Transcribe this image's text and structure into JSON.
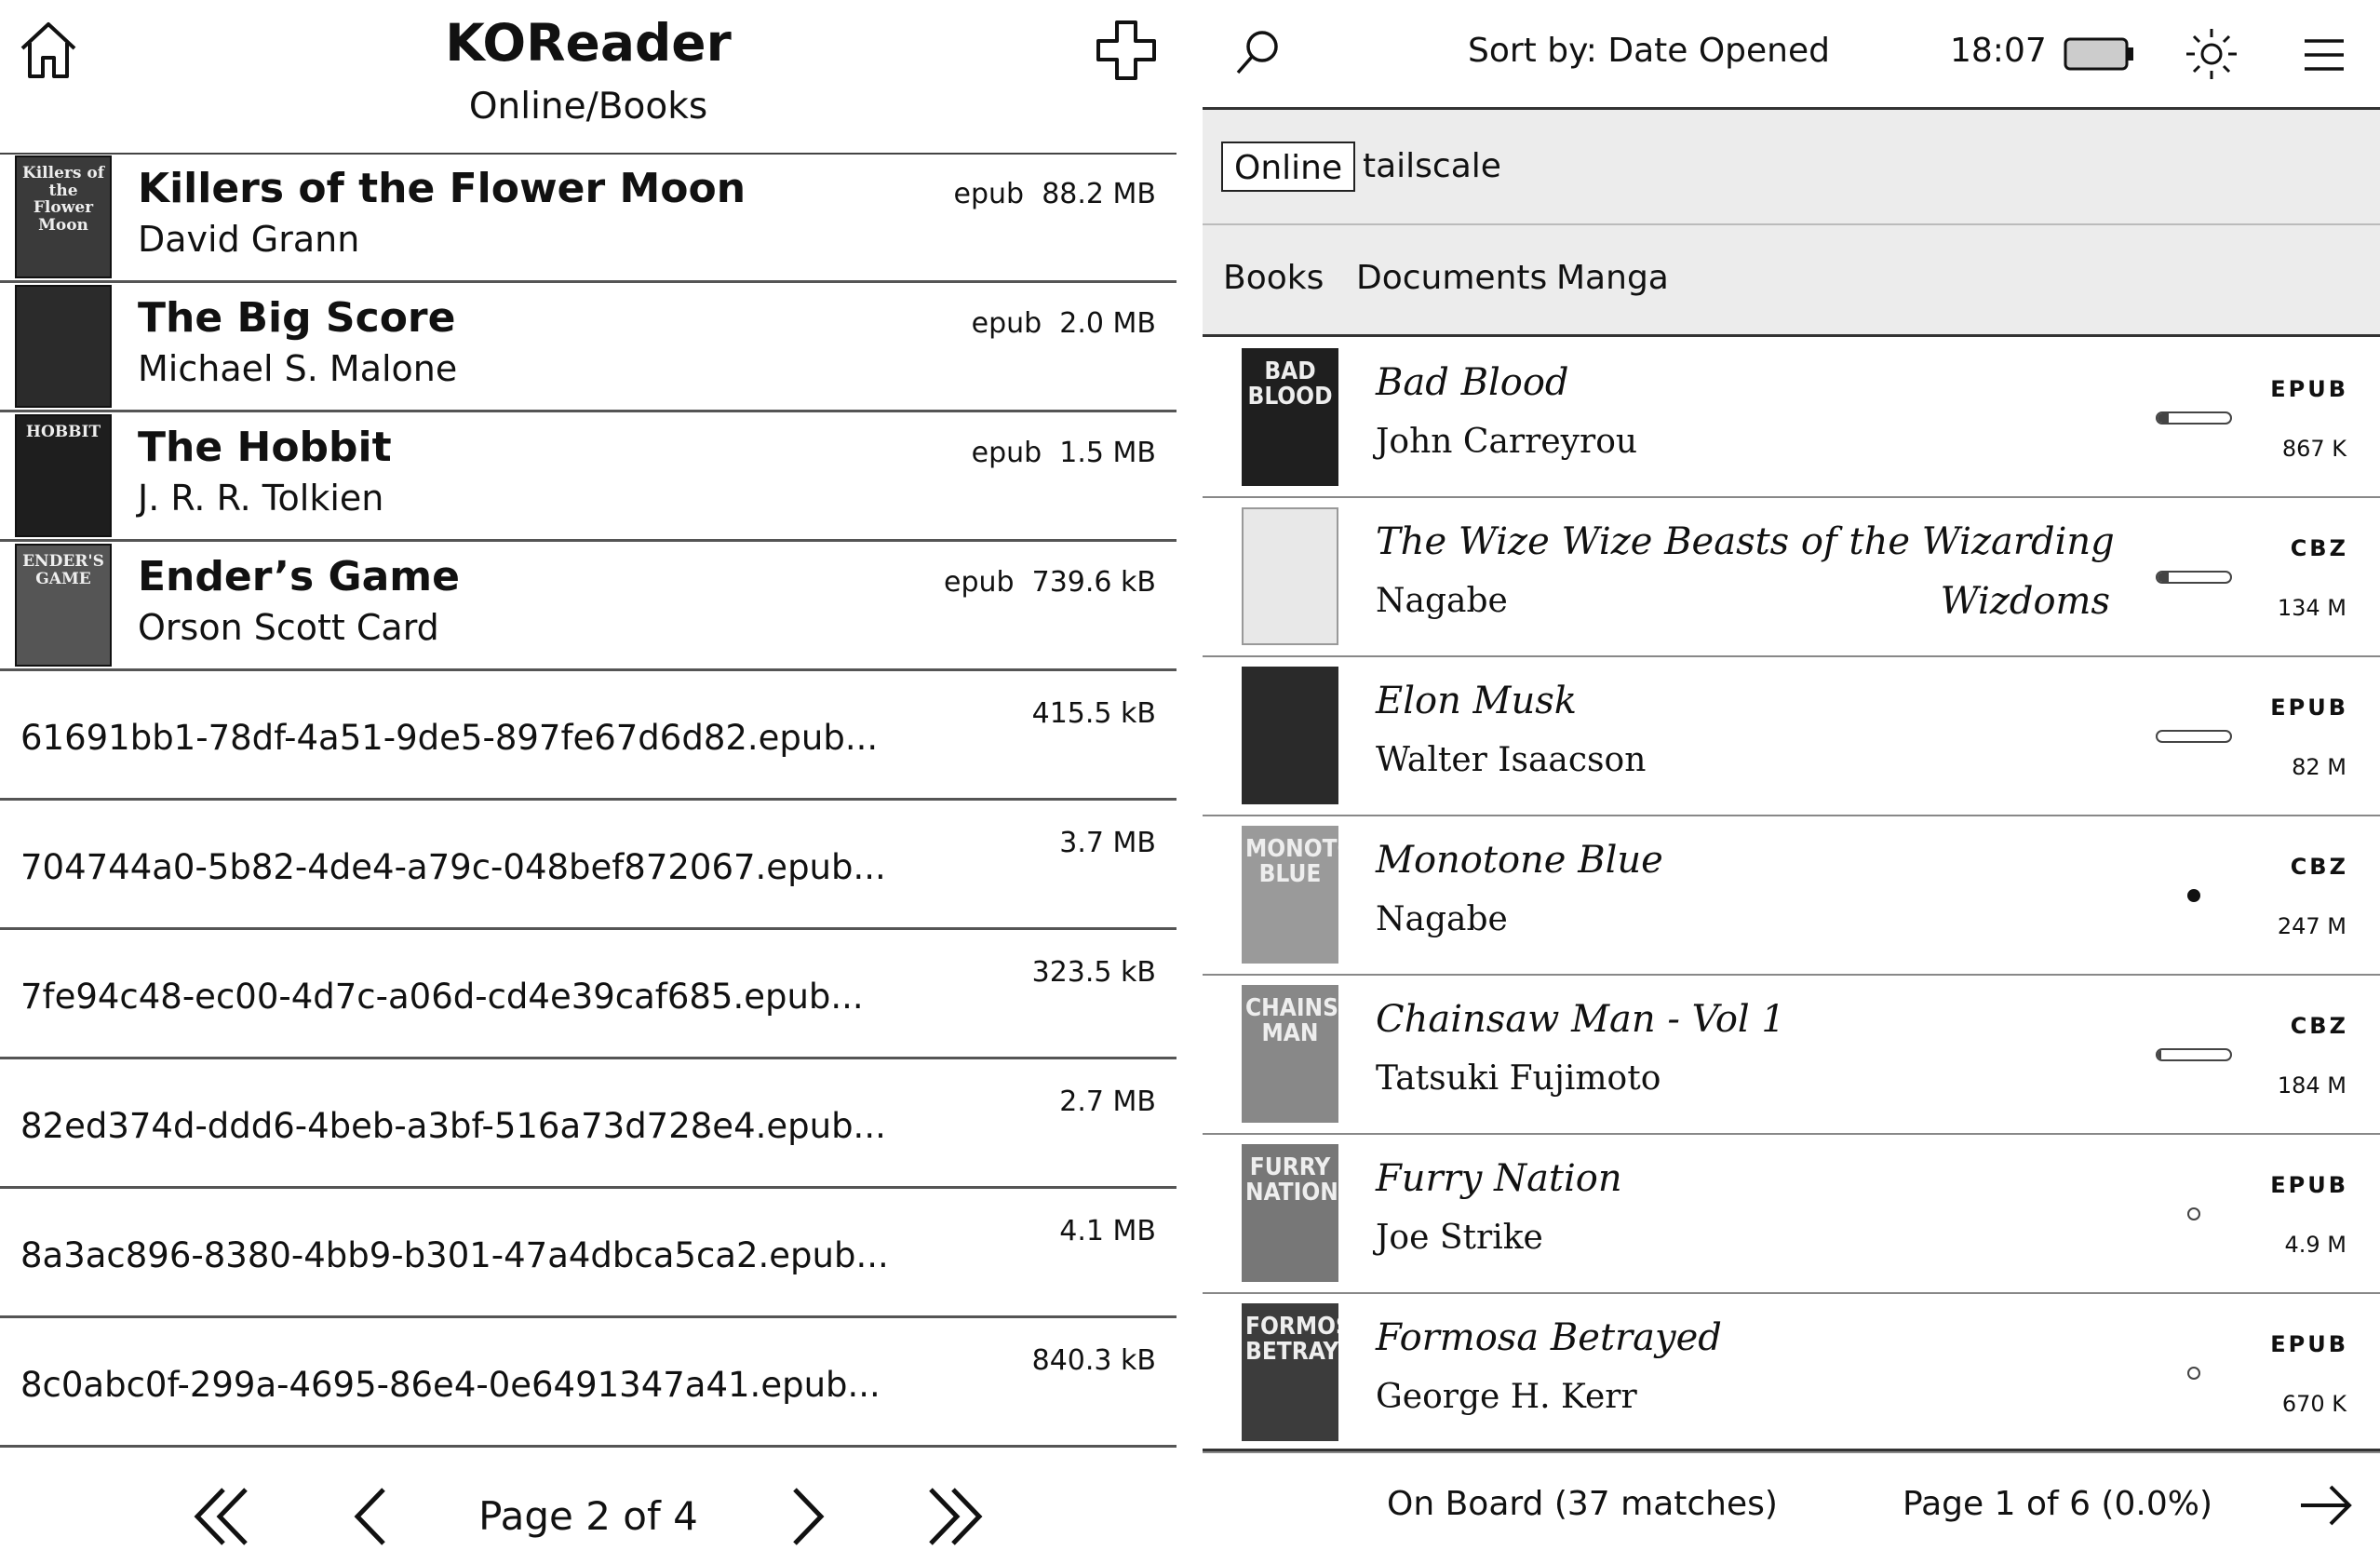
{
  "left": {
    "header": {
      "title": "KOReader",
      "subtitle": "Online/Books"
    },
    "books": [
      {
        "title": "Killers of the Flower Moon",
        "author": "David Grann",
        "format": "epub",
        "size": "88.2 MB",
        "cover_text": "Killers of the Flower Moon"
      },
      {
        "title": "The Big Score",
        "author": "Michael S. Malone",
        "format": "epub",
        "size": "2.0 MB",
        "cover_text": ""
      },
      {
        "title": "The Hobbit",
        "author": "J. R. R. Tolkien",
        "format": "epub",
        "size": "1.5 MB",
        "cover_text": "HOBBIT"
      },
      {
        "title": "Ender’s Game",
        "author": "Orson Scott Card",
        "format": "epub",
        "size": "739.6 kB",
        "cover_text": "ENDER'S GAME"
      }
    ],
    "files": [
      {
        "name": "61691bb1-78df-4a51-9de5-897fe67d6d82.epub...",
        "size": "415.5 kB"
      },
      {
        "name": "704744a0-5b82-4de4-a79c-048bef872067.epub...",
        "size": "3.7 MB"
      },
      {
        "name": "7fe94c48-ec00-4d7c-a06d-cd4e39caf685.epub...",
        "size": "323.5 kB"
      },
      {
        "name": "82ed374d-ddd6-4beb-a3bf-516a73d728e4.epub...",
        "size": "2.7 MB"
      },
      {
        "name": "8a3ac896-8380-4bb9-b301-47a4dbca5ca2.epub...",
        "size": "4.1 MB"
      },
      {
        "name": "8c0abc0f-299a-4695-86e4-0e6491347a41.epub...",
        "size": "840.3 kB"
      }
    ],
    "footer": {
      "page_label": "Page 2 of 4"
    }
  },
  "right": {
    "top": {
      "sort_label": "Sort by: Date Opened",
      "time": "18:07"
    },
    "search": {
      "mode": "Online",
      "query": "tailscale"
    },
    "tabs": [
      "Books",
      "Documents",
      "Manga"
    ],
    "items": [
      {
        "title": "Bad Blood",
        "title_cont": "",
        "author": "John Carreyrou",
        "format": "EPUB",
        "size": "867 K",
        "status": "progress",
        "progress": 0.15,
        "cover_text": "BAD BLOOD"
      },
      {
        "title": "The Wize Wize Beasts of the Wizarding",
        "title_cont": "Wizdoms",
        "author": "Nagabe",
        "format": "CBZ",
        "size": "134 M",
        "status": "progress",
        "progress": 0.15,
        "cover_text": ""
      },
      {
        "title": "Elon Musk",
        "title_cont": "",
        "author": "Walter Isaacson",
        "format": "EPUB",
        "size": "82 M",
        "status": "progress",
        "progress": 0.0,
        "cover_text": ""
      },
      {
        "title": "Monotone Blue",
        "title_cont": "",
        "author": "Nagabe",
        "format": "CBZ",
        "size": "247 M",
        "status": "dot-filled",
        "progress": null,
        "cover_text": "MONOTONE BLUE"
      },
      {
        "title": "Chainsaw Man - Vol 1",
        "title_cont": "",
        "author": "Tatsuki Fujimoto",
        "format": "CBZ",
        "size": "184 M",
        "status": "progress",
        "progress": 0.05,
        "cover_text": "CHAINSAW MAN"
      },
      {
        "title": "Furry Nation",
        "title_cont": "",
        "author": "Joe Strike",
        "format": "EPUB",
        "size": "4.9 M",
        "status": "dot-empty",
        "progress": null,
        "cover_text": "FURRY NATION"
      },
      {
        "title": "Formosa Betrayed",
        "title_cont": "",
        "author": "George H. Kerr",
        "format": "EPUB",
        "size": "670 K",
        "status": "dot-empty",
        "progress": null,
        "cover_text": "FORMOSA BETRAYED"
      }
    ],
    "footer": {
      "matches": "On Board (37 matches)",
      "page": "Page 1 of 6 (0.0%)"
    }
  },
  "icons": [
    "home-icon",
    "plus-icon",
    "first-page-icon",
    "prev-page-icon",
    "next-page-icon",
    "last-page-icon",
    "search-icon",
    "battery-icon",
    "brightness-icon",
    "menu-icon",
    "arrow-right-icon"
  ],
  "colors": {
    "text": "#111111",
    "panel_gray": "#ececec",
    "background": "#ffffff"
  }
}
